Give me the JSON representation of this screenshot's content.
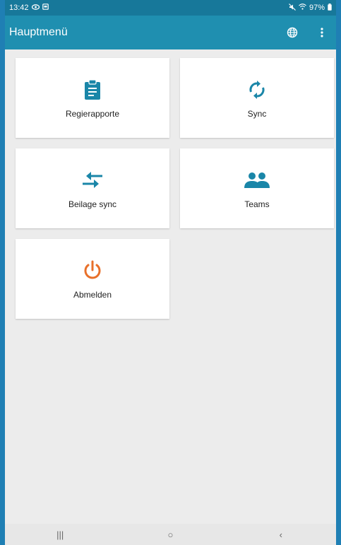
{
  "status": {
    "time": "13:42",
    "battery": "97%"
  },
  "appbar": {
    "title": "Hauptmenü",
    "globe_icon": "globe-icon",
    "more_icon": "more-vert-icon"
  },
  "tiles": [
    {
      "label": "Regierapporte",
      "icon": "clipboard-icon",
      "color": "#1a86a8"
    },
    {
      "label": "Sync",
      "icon": "sync-icon",
      "color": "#1a86a8"
    },
    {
      "label": "Beilage sync",
      "icon": "arrows-compare-icon",
      "color": "#1a86a8"
    },
    {
      "label": "Teams",
      "icon": "group-icon",
      "color": "#1a86a8"
    },
    {
      "label": "Abmelden",
      "icon": "power-icon",
      "color": "#e8702a"
    }
  ],
  "navbar": {
    "recents": "|||",
    "home": "○",
    "back": "‹"
  }
}
